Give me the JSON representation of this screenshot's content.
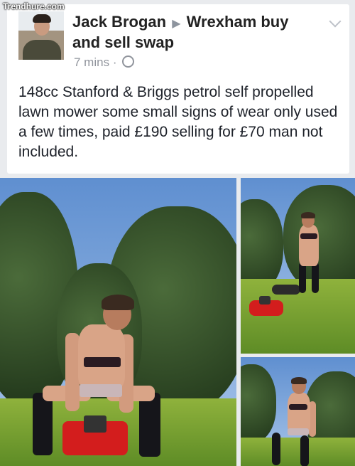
{
  "watermark": "Trendhure.com",
  "post": {
    "author": "Jack Brogan",
    "arrow": "▶",
    "group": "Wrexham buy and sell swap",
    "time": "7 mins",
    "separator": "·",
    "body": "148cc Stanford & Briggs petrol self propelled lawn mower some small signs of wear only used a few times, paid £190 selling for £70 man not included.",
    "icons": {
      "privacy": "globe-icon",
      "menu": "chevron-down-icon"
    }
  },
  "photos": [
    {
      "subject": "man-on-mower-main"
    },
    {
      "subject": "man-pushing-mower"
    },
    {
      "subject": "man-posing-garden"
    }
  ],
  "colors": {
    "name": "#222222",
    "meta": "#90949c",
    "text": "#1d2129",
    "mower": "#d31d1d"
  }
}
